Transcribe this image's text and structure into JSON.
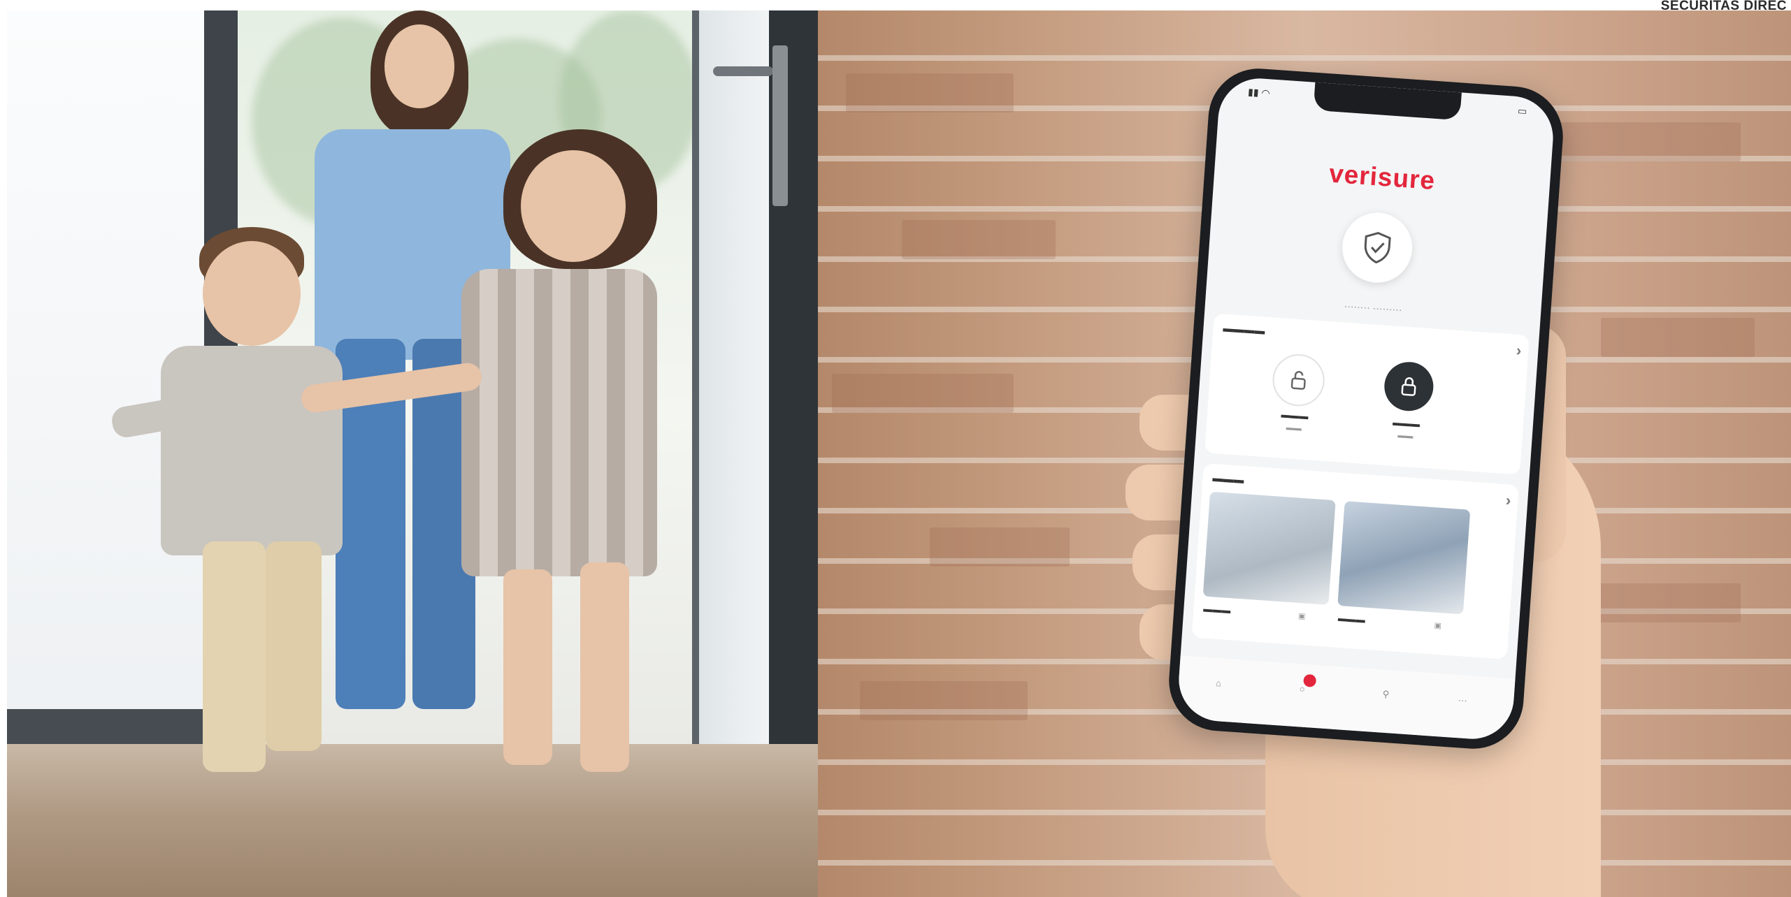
{
  "photo_credit": "SECURITAS DIREC",
  "app": {
    "brand": "verisure",
    "accent_color": "#e3263c",
    "status_icon": "shield-check-icon",
    "smart_lock_section": {
      "locks": [
        {
          "icon": "lock-open-icon"
        },
        {
          "icon": "lock-closed-icon"
        }
      ]
    },
    "cameras_section": {
      "cameras": [
        {
          "icon": "camera-icon"
        },
        {
          "icon": "camera-icon"
        }
      ]
    },
    "nav": [
      {
        "icon": "home-icon"
      },
      {
        "icon": "alerts-icon"
      },
      {
        "icon": "smartplug-icon"
      },
      {
        "icon": "more-icon"
      }
    ]
  }
}
